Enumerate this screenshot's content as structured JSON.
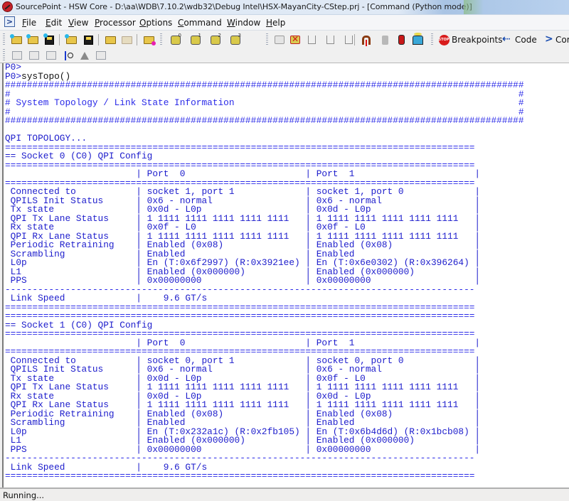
{
  "window": {
    "title": "SourcePoint - HSW Core - D:\\aa\\WDB\\7.10.2\\wdb32\\Debug Intel\\HSX-MayanCity-CStep.prj - [Command (Python mode)]",
    "app_icon": "sourcepoint-logo-icon"
  },
  "menubar": {
    "icon": "command-prompt-icon",
    "items": [
      {
        "label": "File",
        "accel": "F"
      },
      {
        "label": "Edit",
        "accel": "E"
      },
      {
        "label": "View",
        "accel": "V"
      },
      {
        "label": "Processor",
        "accel": "P"
      },
      {
        "label": "Options",
        "accel": "O"
      },
      {
        "label": "Command",
        "accel": "C"
      },
      {
        "label": "Window",
        "accel": "W"
      },
      {
        "label": "Help",
        "accel": "H"
      }
    ]
  },
  "toolbar": {
    "breakpoints_label": "Breakpoints",
    "code_label": "Code",
    "command_label": "Cor"
  },
  "console": {
    "lines": [
      {
        "text": "P0>",
        "kind": "prompt"
      },
      {
        "prompt": "P0>",
        "input": "sysTopo()",
        "kind": "input"
      }
    ],
    "banner_title": "System Topology / Link State Information",
    "topology_heading": "QPI TOPOLOGY...",
    "row_labels": [
      "Connected to",
      "QPILS Init Status",
      "Tx state",
      "QPI Tx Lane Status",
      "Rx state",
      "QPI Rx Lane Status",
      "Periodic Retraining",
      "Scrambling",
      "L0p",
      "L1",
      "PPS"
    ],
    "link_speed_label": "Link Speed",
    "sockets": [
      {
        "heading": "== Socket 0 (C0) QPI Config",
        "ports": [
          {
            "header": "Port  0",
            "values": [
              "socket 1, port 1",
              "0x6 - normal",
              "0x0d - L0p",
              "1 1111 1111 1111 1111 1111",
              "0x0f - L0",
              "1 1111 1111 1111 1111 1111",
              "Enabled (0x08)",
              "Enabled",
              "En (T:0x6f2997) (R:0x3921ee)",
              "Enabled (0x000000)",
              "0x00000000"
            ]
          },
          {
            "header": "Port  1",
            "values": [
              "socket 1, port 0",
              "0x6 - normal",
              "0x0d - L0p",
              "1 1111 1111 1111 1111 1111",
              "0x0f - L0",
              "1 1111 1111 1111 1111 1111",
              "Enabled (0x08)",
              "Enabled",
              "En (T:0x6e0302) (R:0x396264)",
              "Enabled (0x000000)",
              "0x00000000"
            ]
          }
        ],
        "link_speed": "9.6 GT/s"
      },
      {
        "heading": "== Socket 1 (C0) QPI Config",
        "ports": [
          {
            "header": "Port  0",
            "values": [
              "socket 0, port 1",
              "0x6 - normal",
              "0x0d - L0p",
              "1 1111 1111 1111 1111 1111",
              "0x0d - L0p",
              "1 1111 1111 1111 1111 1111",
              "Enabled (0x08)",
              "Enabled",
              "En (T:0x232a1c) (R:0x2fb105)",
              "Enabled (0x000000)",
              "0x00000000"
            ]
          },
          {
            "header": "Port  1",
            "values": [
              "socket 0, port 0",
              "0x6 - normal",
              "0x0f - L0",
              "1 1111 1111 1111 1111 1111",
              "0x0d - L0p",
              "1 1111 1111 1111 1111 1111",
              "Enabled (0x08)",
              "Enabled",
              "En (T:0x6b4d6d) (R:0x1bcb08)",
              "Enabled (0x000000)",
              "0x00000000"
            ]
          }
        ],
        "link_speed": "9.6 GT/s"
      }
    ]
  },
  "statusbar": {
    "text": "Running..."
  },
  "colors": {
    "console_text": "#1c1ccc",
    "console_background": "#ffffff",
    "prompt_input": "#111111"
  }
}
